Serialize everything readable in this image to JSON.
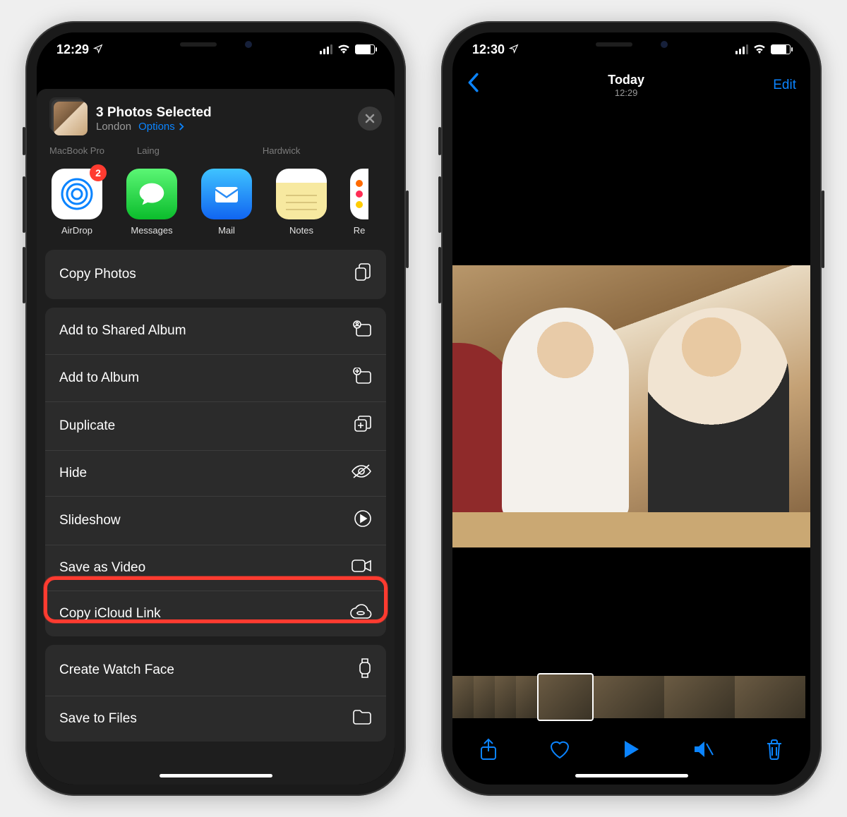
{
  "colors": {
    "accent": "#0b84ff",
    "highlight": "#ff3b30"
  },
  "phoneA": {
    "status": {
      "time": "12:29"
    },
    "sheet": {
      "title": "3 Photos Selected",
      "location": "London",
      "options_label": "Options",
      "airdrop_peek": [
        "MacBook Pro",
        "Laing",
        "Hardwick"
      ],
      "apps": [
        {
          "name": "AirDrop",
          "badge": "2"
        },
        {
          "name": "Messages"
        },
        {
          "name": "Mail"
        },
        {
          "name": "Notes"
        },
        {
          "name": "Re"
        }
      ],
      "actions_group1": [
        {
          "label": "Copy Photos",
          "icon": "copy"
        }
      ],
      "actions_group2": [
        {
          "label": "Add to Shared Album",
          "icon": "shared-album"
        },
        {
          "label": "Add to Album",
          "icon": "add-album"
        },
        {
          "label": "Duplicate",
          "icon": "duplicate"
        },
        {
          "label": "Hide",
          "icon": "hide"
        },
        {
          "label": "Slideshow",
          "icon": "play-circle"
        },
        {
          "label": "Save as Video",
          "icon": "video",
          "highlight": true
        },
        {
          "label": "Copy iCloud Link",
          "icon": "cloud-link"
        }
      ],
      "actions_group3": [
        {
          "label": "Create Watch Face",
          "icon": "watch"
        },
        {
          "label": "Save to Files",
          "icon": "folder"
        }
      ]
    }
  },
  "phoneB": {
    "status": {
      "time": "12:30"
    },
    "nav": {
      "title": "Today",
      "subtitle": "12:29",
      "edit": "Edit"
    },
    "toolbar": [
      "share",
      "heart",
      "play",
      "mute",
      "trash"
    ],
    "filmstrip_count": 8
  }
}
